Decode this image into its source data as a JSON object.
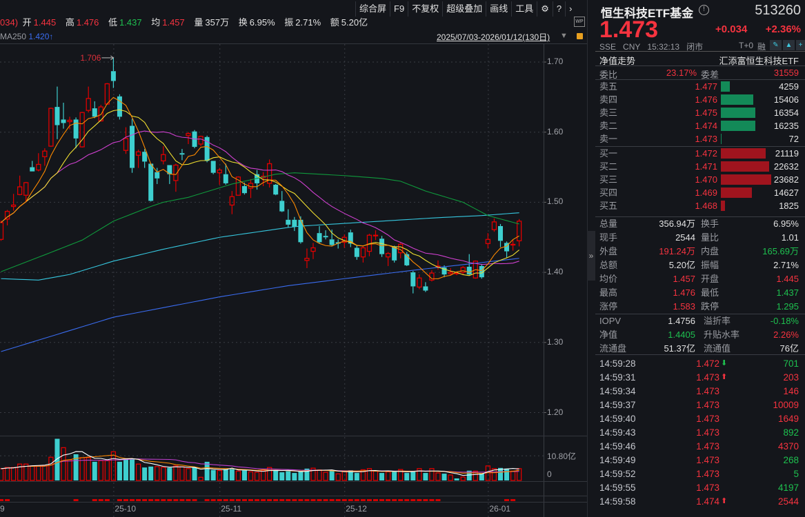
{
  "toolbar": {
    "items": [
      "综合屏",
      "F9",
      "不复权",
      "超级叠加",
      "画线",
      "工具"
    ],
    "icons": [
      "gear-icon",
      "help-icon",
      "chevron-right-icon"
    ]
  },
  "quote_bar": {
    "change_tail": "034)",
    "open_label": "开",
    "open": "1.445",
    "high_label": "高",
    "high": "1.476",
    "low_label": "低",
    "low": "1.437",
    "avg_label": "均",
    "avg": "1.457",
    "vol_label": "量",
    "vol": "357万",
    "turnover_label": "换",
    "turnover": "6.95%",
    "amp_label": "振",
    "amp": "2.71%",
    "amount_label": "额",
    "amount": "5.20亿",
    "wp_icon": "WP"
  },
  "ma_legend": {
    "label": "MA250",
    "value": "1.420",
    "arrow": "↑"
  },
  "range": {
    "text": "2025/07/03-2026/01/12(130日)"
  },
  "colors": {
    "up": "#e00000",
    "down": "#3ecfcf",
    "ma5": "#ff8a00",
    "ma10": "#f2e030",
    "ma20": "#d040d0",
    "ma60": "#0f9a3c",
    "ma120": "#36c8e0",
    "ma250": "#3a6cf0",
    "vma5": "#ffffff",
    "vma10": "#ff8a00",
    "vma20": "#c040d0"
  },
  "chart_data": {
    "type": "candlestick",
    "y_ticks": [
      "1.70",
      "1.60",
      "1.50",
      "1.40",
      "1.30",
      "1.20"
    ],
    "ylim": [
      1.17,
      1.73
    ],
    "max_marker": {
      "label": "1.706",
      "index": 18
    },
    "x_ticks": [
      {
        "label": "9",
        "index": 0
      },
      {
        "label": "25-10",
        "index": 18
      },
      {
        "label": "25-11",
        "index": 35
      },
      {
        "label": "25-12",
        "index": 55
      },
      {
        "label": "26-01",
        "index": 78
      }
    ],
    "ohlc": [
      [
        1.447,
        1.474,
        1.445,
        1.471
      ],
      [
        1.476,
        1.489,
        1.467,
        1.487
      ],
      [
        1.494,
        1.512,
        1.488,
        1.496
      ],
      [
        1.511,
        1.538,
        1.51,
        1.522
      ],
      [
        1.51,
        1.529,
        1.5,
        1.528
      ],
      [
        1.55,
        1.559,
        1.544,
        1.544
      ],
      [
        1.546,
        1.57,
        1.544,
        1.554
      ],
      [
        1.565,
        1.577,
        1.552,
        1.573
      ],
      [
        1.58,
        1.635,
        1.579,
        1.634
      ],
      [
        1.636,
        1.665,
        1.59,
        1.61
      ],
      [
        1.618,
        1.642,
        1.605,
        1.613
      ],
      [
        1.615,
        1.622,
        1.604,
        1.617
      ],
      [
        1.618,
        1.621,
        1.577,
        1.591
      ],
      [
        1.579,
        1.629,
        1.578,
        1.628
      ],
      [
        1.631,
        1.665,
        1.628,
        1.648
      ],
      [
        1.634,
        1.644,
        1.62,
        1.622
      ],
      [
        1.616,
        1.639,
        1.615,
        1.636
      ],
      [
        1.64,
        1.67,
        1.639,
        1.669
      ],
      [
        1.687,
        1.706,
        1.663,
        1.673
      ],
      [
        1.651,
        1.654,
        1.618,
        1.622
      ],
      [
        1.574,
        1.607,
        1.569,
        1.591
      ],
      [
        1.609,
        1.619,
        1.542,
        1.549
      ],
      [
        1.567,
        1.575,
        1.549,
        1.572
      ],
      [
        1.572,
        1.576,
        1.549,
        1.558
      ],
      [
        1.555,
        1.555,
        1.501,
        1.502
      ],
      [
        1.543,
        1.549,
        1.526,
        1.534
      ],
      [
        1.559,
        1.58,
        1.554,
        1.568
      ],
      [
        1.553,
        1.553,
        1.526,
        1.54
      ],
      [
        1.531,
        1.555,
        1.515,
        1.553
      ],
      [
        1.57,
        1.576,
        1.56,
        1.568
      ],
      [
        1.595,
        1.6,
        1.583,
        1.598
      ],
      [
        1.601,
        1.603,
        1.577,
        1.579
      ],
      [
        1.583,
        1.595,
        1.58,
        1.594
      ],
      [
        1.593,
        1.595,
        1.557,
        1.559
      ],
      [
        1.559,
        1.559,
        1.54,
        1.542
      ],
      [
        1.542,
        1.549,
        1.525,
        1.546
      ],
      [
        1.54,
        1.555,
        1.525,
        1.527
      ],
      [
        1.496,
        1.516,
        1.483,
        1.508
      ],
      [
        1.51,
        1.537,
        1.51,
        1.536
      ],
      [
        1.523,
        1.528,
        1.511,
        1.513
      ],
      [
        1.52,
        1.533,
        1.506,
        1.527
      ],
      [
        1.54,
        1.546,
        1.518,
        1.527
      ],
      [
        1.535,
        1.543,
        1.523,
        1.537
      ],
      [
        1.527,
        1.561,
        1.521,
        1.555
      ],
      [
        1.525,
        1.526,
        1.51,
        1.511
      ],
      [
        1.502,
        1.516,
        1.486,
        1.487
      ],
      [
        1.475,
        1.49,
        1.464,
        1.468
      ],
      [
        1.475,
        1.479,
        1.459,
        1.465
      ],
      [
        1.475,
        1.48,
        1.441,
        1.443
      ],
      [
        1.417,
        1.434,
        1.406,
        1.42
      ],
      [
        1.43,
        1.442,
        1.419,
        1.435
      ],
      [
        1.456,
        1.466,
        1.441,
        1.443
      ],
      [
        1.452,
        1.46,
        1.447,
        1.45
      ],
      [
        1.447,
        1.461,
        1.437,
        1.439
      ],
      [
        1.443,
        1.447,
        1.434,
        1.441
      ],
      [
        1.443,
        1.454,
        1.435,
        1.45
      ],
      [
        1.457,
        1.461,
        1.436,
        1.441
      ],
      [
        1.435,
        1.438,
        1.418,
        1.422
      ],
      [
        1.422,
        1.437,
        1.414,
        1.435
      ],
      [
        1.43,
        1.455,
        1.423,
        1.453
      ],
      [
        1.452,
        1.46,
        1.446,
        1.453
      ],
      [
        1.448,
        1.452,
        1.422,
        1.426
      ],
      [
        1.422,
        1.429,
        1.409,
        1.427
      ],
      [
        1.437,
        1.438,
        1.414,
        1.417
      ],
      [
        1.428,
        1.442,
        1.42,
        1.44
      ],
      [
        1.426,
        1.429,
        1.409,
        1.41
      ],
      [
        1.4,
        1.402,
        1.37,
        1.38
      ],
      [
        1.379,
        1.397,
        1.376,
        1.392
      ],
      [
        1.38,
        1.386,
        1.372,
        1.374
      ],
      [
        1.389,
        1.403,
        1.387,
        1.399
      ],
      [
        1.408,
        1.417,
        1.404,
        1.409
      ],
      [
        1.407,
        1.41,
        1.393,
        1.397
      ],
      [
        1.398,
        1.406,
        1.396,
        1.4
      ],
      [
        1.398,
        1.401,
        1.396,
        1.399
      ],
      [
        1.4,
        1.409,
        1.397,
        1.407
      ],
      [
        1.408,
        1.426,
        1.396,
        1.397
      ],
      [
        1.392,
        1.417,
        1.391,
        1.416
      ],
      [
        1.409,
        1.412,
        1.391,
        1.393
      ],
      [
        1.441,
        1.456,
        1.434,
        1.447
      ],
      [
        1.461,
        1.477,
        1.458,
        1.472
      ],
      [
        1.466,
        1.469,
        1.436,
        1.445
      ],
      [
        1.442,
        1.444,
        1.421,
        1.43
      ],
      [
        1.439,
        1.447,
        1.431,
        1.44
      ],
      [
        1.445,
        1.476,
        1.437,
        1.473
      ]
    ],
    "ma_long": {
      "ma60": [
        [
          0,
          1.401
        ],
        [
          7,
          1.425
        ],
        [
          13,
          1.446
        ],
        [
          18,
          1.473
        ],
        [
          24,
          1.494
        ],
        [
          26,
          1.5
        ],
        [
          30,
          1.507
        ],
        [
          37,
          1.526
        ],
        [
          44,
          1.54
        ],
        [
          47,
          1.542
        ],
        [
          55,
          1.538
        ],
        [
          61,
          1.534
        ],
        [
          64,
          1.53
        ],
        [
          68,
          1.516
        ],
        [
          74,
          1.5
        ],
        [
          78,
          1.481
        ],
        [
          83,
          1.469
        ]
      ],
      "ma120": [
        [
          0,
          1.391
        ],
        [
          6,
          1.389
        ],
        [
          11,
          1.397
        ],
        [
          18,
          1.416
        ],
        [
          26,
          1.433
        ],
        [
          35,
          1.45
        ],
        [
          46,
          1.464
        ],
        [
          48,
          1.466
        ],
        [
          59,
          1.472
        ],
        [
          70,
          1.478
        ],
        [
          77,
          1.481
        ],
        [
          83,
          1.485
        ]
      ],
      "ma250": [
        [
          0,
          1.287
        ],
        [
          18,
          1.336
        ],
        [
          35,
          1.365
        ],
        [
          46,
          1.381
        ],
        [
          55,
          1.391
        ],
        [
          66,
          1.403
        ],
        [
          77,
          1.414
        ],
        [
          83,
          1.42
        ]
      ]
    },
    "volume_unit": "亿",
    "volume_ticks": [
      "10.80亿",
      "0"
    ],
    "volume": [
      5.2,
      5.7,
      5.7,
      7.2,
      7.2,
      6.4,
      6.4,
      6.4,
      10.2,
      18.3,
      14.4,
      9.0,
      11.5,
      10.0,
      10.0,
      8.2,
      8.7,
      8.7,
      12.6,
      8.2,
      9.2,
      9.2,
      7.2,
      5.7,
      6.1,
      6.1,
      5.7,
      5.6,
      6.4,
      6.0,
      5.2,
      5.6,
      1.4,
      8.2,
      4.6,
      4.4,
      5.0,
      5.0,
      4.1,
      4.4,
      3.8,
      3.6,
      4.3,
      5.7,
      4.6,
      3.6,
      4.1,
      3.3,
      3.9,
      5.2,
      5.4,
      4.6,
      3.6,
      4.3,
      2.9,
      3.9,
      4.5,
      3.3,
      4.7,
      5.2,
      4.1,
      3.3,
      3.8,
      3.8,
      4.8,
      3.3,
      3.8,
      5.2,
      3.3,
      5.2,
      3.3,
      3.0,
      2.4,
      0.9,
      1.5,
      4.3,
      4.1,
      3.0,
      6.4,
      5.2,
      5.5,
      5.2,
      4.1,
      5.2
    ],
    "signal_days": [
      0,
      1,
      12,
      15,
      16,
      17,
      19,
      20,
      21,
      22,
      23,
      24,
      25,
      26,
      27,
      28,
      29,
      30,
      31,
      33,
      34,
      35,
      36,
      37,
      38,
      39,
      40,
      41,
      42,
      43,
      44,
      45,
      46,
      47,
      48,
      49,
      50,
      51,
      52,
      53,
      54,
      55,
      56,
      57,
      58,
      59,
      60,
      61,
      62,
      63,
      64,
      65,
      66,
      67,
      68,
      69,
      70,
      81,
      82
    ]
  },
  "panel": {
    "name": "恒生科技ETF基金",
    "code": "513260",
    "price": "1.473",
    "change": "+0.034",
    "change_pct": "+2.36%",
    "exchange": "SSE",
    "currency": "CNY",
    "time": "15:32:13",
    "status": "闭市",
    "t0": "T+0",
    "margin": "融",
    "nav_trend": "净值走势",
    "fund_name": "汇添富恒生科技ETF",
    "weibi_label": "委比",
    "weibi": "23.17%",
    "weicha_label": "委差",
    "weicha": "31559",
    "asks": [
      {
        "label": "卖五",
        "price": "1.477",
        "vol": "4259",
        "v": 4259
      },
      {
        "label": "卖四",
        "price": "1.476",
        "vol": "15406",
        "v": 15406
      },
      {
        "label": "卖三",
        "price": "1.475",
        "vol": "16354",
        "v": 16354
      },
      {
        "label": "卖二",
        "price": "1.474",
        "vol": "16235",
        "v": 16235
      },
      {
        "label": "卖一",
        "price": "1.473",
        "vol": "72",
        "v": 72
      }
    ],
    "bids": [
      {
        "label": "买一",
        "price": "1.472",
        "vol": "21119",
        "v": 21119
      },
      {
        "label": "买二",
        "price": "1.471",
        "vol": "22632",
        "v": 22632
      },
      {
        "label": "买三",
        "price": "1.470",
        "vol": "23682",
        "v": 23682
      },
      {
        "label": "买四",
        "price": "1.469",
        "vol": "14627",
        "v": 14627
      },
      {
        "label": "买五",
        "price": "1.468",
        "vol": "1825",
        "v": 1825
      }
    ],
    "stats": [
      [
        {
          "l": "总量",
          "v": "356.94万",
          "c": "white"
        },
        {
          "l": "换手",
          "v": "6.95%",
          "c": "white"
        }
      ],
      [
        {
          "l": "现手",
          "v": "2544",
          "c": "white"
        },
        {
          "l": "量比",
          "v": "1.01",
          "c": "white"
        }
      ],
      [
        {
          "l": "外盘",
          "v": "191.24万",
          "c": "red"
        },
        {
          "l": "内盘",
          "v": "165.69万",
          "c": "green"
        }
      ],
      [
        {
          "l": "总额",
          "v": "5.20亿",
          "c": "white"
        },
        {
          "l": "振幅",
          "v": "2.71%",
          "c": "white"
        }
      ],
      [
        {
          "l": "均价",
          "v": "1.457",
          "c": "red"
        },
        {
          "l": "开盘",
          "v": "1.445",
          "c": "red"
        }
      ],
      [
        {
          "l": "最高",
          "v": "1.476",
          "c": "red"
        },
        {
          "l": "最低",
          "v": "1.437",
          "c": "green"
        }
      ],
      [
        {
          "l": "涨停",
          "v": "1.583",
          "c": "red"
        },
        {
          "l": "跌停",
          "v": "1.295",
          "c": "green"
        }
      ]
    ],
    "nav_stats": [
      [
        {
          "l": "IOPV",
          "v": "1.4756",
          "c": "white"
        },
        {
          "l": "溢折率",
          "v": "-0.18%",
          "c": "green"
        }
      ],
      [
        {
          "l": "净值",
          "v": "1.4405",
          "c": "green"
        },
        {
          "l": "升贴水率",
          "v": "2.26%",
          "c": "red"
        }
      ],
      [
        {
          "l": "流通盘",
          "v": "51.37亿",
          "c": "white"
        },
        {
          "l": "流通值",
          "v": "76亿",
          "c": "white"
        }
      ]
    ],
    "ticks": [
      {
        "time": "14:59:28",
        "price": "1.472",
        "dir": "down",
        "vol": "701",
        "c": "green"
      },
      {
        "time": "14:59:31",
        "price": "1.473",
        "dir": "up",
        "vol": "203",
        "c": "red"
      },
      {
        "time": "14:59:34",
        "price": "1.473",
        "dir": "",
        "vol": "146",
        "c": "red"
      },
      {
        "time": "14:59:37",
        "price": "1.473",
        "dir": "",
        "vol": "10009",
        "c": "red"
      },
      {
        "time": "14:59:40",
        "price": "1.473",
        "dir": "",
        "vol": "1649",
        "c": "red"
      },
      {
        "time": "14:59:43",
        "price": "1.473",
        "dir": "",
        "vol": "892",
        "c": "green"
      },
      {
        "time": "14:59:46",
        "price": "1.473",
        "dir": "",
        "vol": "4370",
        "c": "red"
      },
      {
        "time": "14:59:49",
        "price": "1.473",
        "dir": "",
        "vol": "268",
        "c": "green"
      },
      {
        "time": "14:59:52",
        "price": "1.473",
        "dir": "",
        "vol": "5",
        "c": "green"
      },
      {
        "time": "14:59:55",
        "price": "1.473",
        "dir": "",
        "vol": "4197",
        "c": "green"
      },
      {
        "time": "14:59:58",
        "price": "1.474",
        "dir": "up",
        "vol": "2544",
        "c": "red"
      }
    ]
  }
}
